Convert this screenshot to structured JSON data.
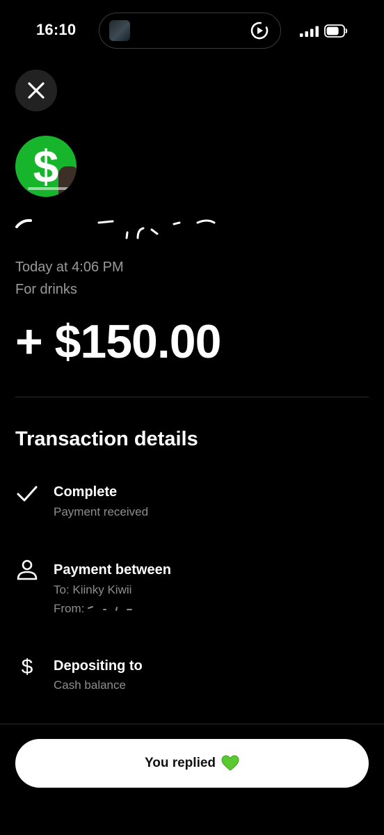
{
  "status_bar": {
    "time": "16:10"
  },
  "icons": {
    "close": "close-icon",
    "check": "check-icon",
    "person": "person-icon",
    "dollar": "dollar-icon",
    "heart": "green-heart-icon"
  },
  "colors": {
    "background": "#000000",
    "accent_green": "#17b52b",
    "secondary_text": "#9a9a9a",
    "button_bg": "#ffffff"
  },
  "transaction": {
    "timestamp": "Today at 4:06 PM",
    "memo": "For drinks",
    "amount": "+ $150.00"
  },
  "details": {
    "title": "Transaction details",
    "status": {
      "title": "Complete",
      "subtitle": "Payment received"
    },
    "parties": {
      "title": "Payment between",
      "to": "To: Kiinky Kiwii",
      "from": "From: "
    },
    "deposit": {
      "title": "Depositing to",
      "subtitle": "Cash balance"
    }
  },
  "footer": {
    "button_label": "You replied"
  }
}
